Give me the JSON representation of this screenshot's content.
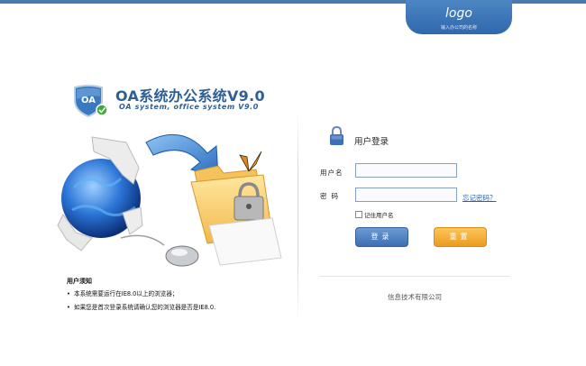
{
  "header": {
    "logo_text": "logo",
    "logo_sub": "输入办公司的名称",
    "accent": "#2f68ad"
  },
  "brand": {
    "badge": "OA",
    "title": "OA系统办公系统V9.0",
    "subtitle": "OA system, office system V9.0"
  },
  "illustration": {
    "icons": [
      "globe-puzzle-icon",
      "arrow-icon",
      "folder-icon",
      "padlock-icon",
      "butterfly-icon",
      "mouse-icon",
      "document-icon"
    ]
  },
  "notice": {
    "title": "用户须知",
    "items": [
      "本系统需要运行在IE8.0以上的浏览器；",
      "如果您是首次登录系统请确认您的浏览器是否是IE8.0."
    ]
  },
  "login": {
    "title": "用户登录",
    "username_label": "用户名",
    "username_value": "",
    "password_label": "密码",
    "password_value": "",
    "forgot": "忘记密码？",
    "remember": "记住用户名",
    "remember_checked": false,
    "login_button": "登录",
    "reset_button": "重置",
    "login_color": "#3c6eb2",
    "reset_color": "#eb9b1f"
  },
  "footer": {
    "company": "信息技术有限公司"
  }
}
